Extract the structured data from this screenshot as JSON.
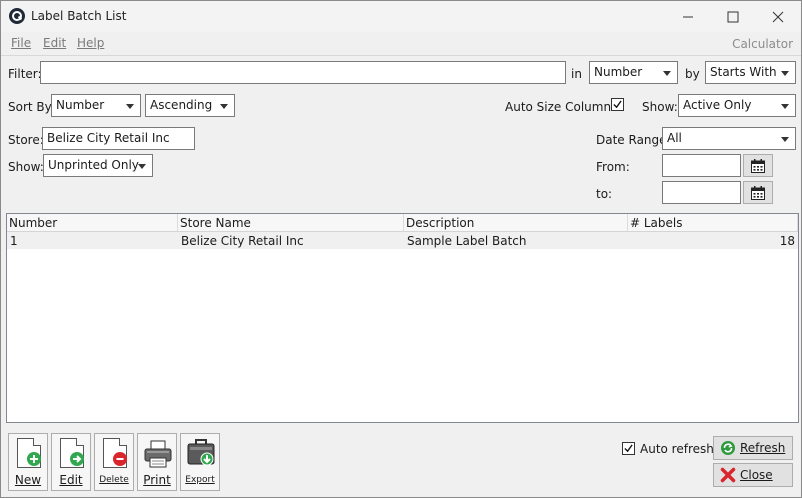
{
  "window": {
    "title": "Label Batch List"
  },
  "menu": {
    "file": "File",
    "edit": "Edit",
    "help": "Help",
    "calculator": "Calculator"
  },
  "filter": {
    "label": "Filter:",
    "value": "",
    "in_label": "in",
    "in_value": "Number",
    "by_label": "by",
    "by_value": "Starts With"
  },
  "sort": {
    "label": "Sort By:",
    "field": "Number",
    "order": "Ascending"
  },
  "auto_size": {
    "label": "Auto Size Columns",
    "checked": true
  },
  "show_top": {
    "label": "Show:",
    "value": "Active Only"
  },
  "store": {
    "label": "Store:",
    "value": "Belize City Retail Inc"
  },
  "show_bottom": {
    "label": "Show:",
    "value": "Unprinted Only"
  },
  "date_range": {
    "label": "Date Range:",
    "value": "All",
    "from_label": "From:",
    "from_value": "",
    "to_label": "to:",
    "to_value": ""
  },
  "table": {
    "columns": [
      "Number",
      "Store Name",
      "Description",
      "# Labels"
    ],
    "rows": [
      {
        "number": "1",
        "store": "Belize City Retail Inc",
        "description": "Sample Label Batch",
        "labels": "18"
      }
    ]
  },
  "buttons": {
    "new": "New",
    "edit": "Edit",
    "delete": "Delete",
    "print": "Print",
    "export": "Export"
  },
  "auto_refresh": {
    "label": "Auto refresh",
    "checked": true
  },
  "refresh": "Refresh",
  "close": "Close",
  "colors": {
    "new_badge": "#2fa84f",
    "edit_badge": "#2fa84f",
    "delete_badge": "#d9262c",
    "close_x": "#d9262c",
    "refresh_icon": "#2e9a3e"
  }
}
